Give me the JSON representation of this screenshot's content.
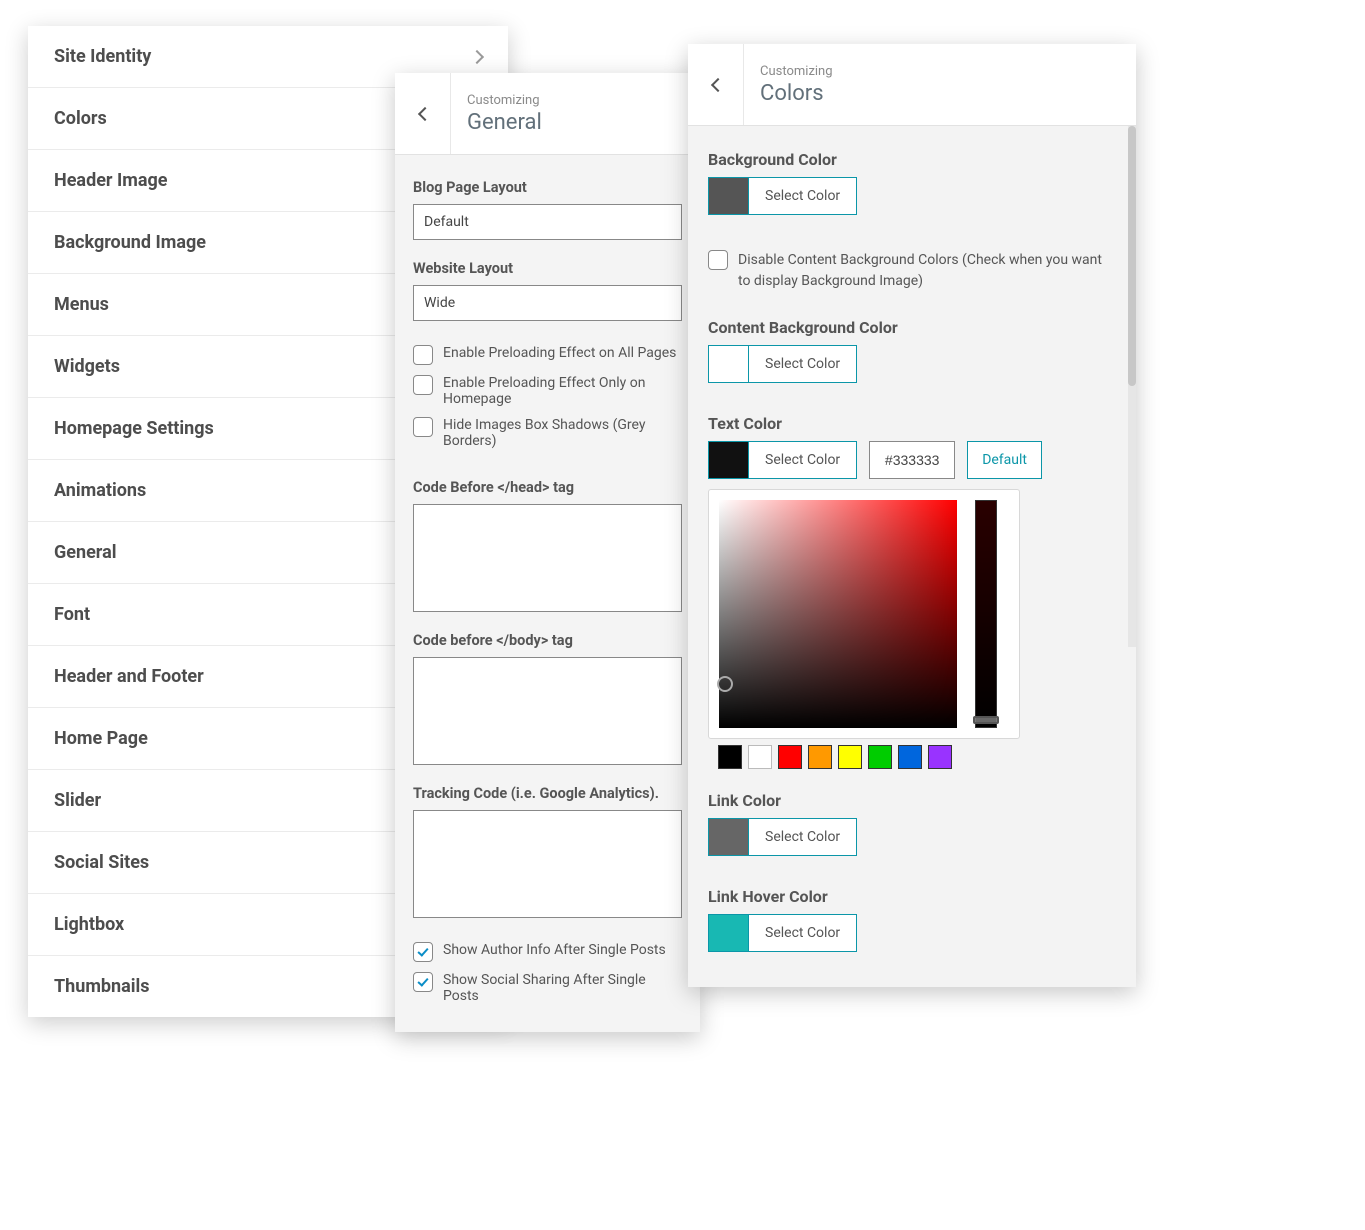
{
  "list_panel": {
    "items": [
      "Site Identity",
      "Colors",
      "Header Image",
      "Background Image",
      "Menus",
      "Widgets",
      "Homepage Settings",
      "Animations",
      "General",
      "Font",
      "Header and Footer",
      "Home Page",
      "Slider",
      "Social Sites",
      "Lightbox",
      "Thumbnails"
    ],
    "active_index": 0
  },
  "general_panel": {
    "header": {
      "crumb": "Customizing",
      "title": "General"
    },
    "blog_layout": {
      "label": "Blog Page Layout",
      "value": "Default"
    },
    "website_layout": {
      "label": "Website Layout",
      "value": "Wide"
    },
    "checkboxes": [
      {
        "label": "Enable Preloading Effect on All Pages",
        "checked": false
      },
      {
        "label": "Enable Preloading Effect Only on Homepage",
        "checked": false
      },
      {
        "label": "Hide Images Box Shadows (Grey Borders)",
        "checked": false
      }
    ],
    "code_head": {
      "label": "Code Before </head> tag"
    },
    "code_body": {
      "label": "Code before </body> tag"
    },
    "tracking": {
      "label": "Tracking Code (i.e. Google Analytics)."
    },
    "after_checks": [
      {
        "label": "Show Author Info After Single Posts",
        "checked": true
      },
      {
        "label": "Show Social Sharing After Single Posts",
        "checked": true
      }
    ]
  },
  "colors_panel": {
    "header": {
      "crumb": "Customizing",
      "title": "Colors"
    },
    "select_color_label": "Select Color",
    "default_label": "Default",
    "background": {
      "label": "Background Color",
      "swatch": "#555555"
    },
    "disable_bg_checkbox": {
      "label": "Disable Content Background Colors (Check when you want to display Background Image)",
      "checked": false
    },
    "content_bg": {
      "label": "Content Background Color",
      "swatch": "#ffffff"
    },
    "text_color": {
      "label": "Text Color",
      "swatch": "#111111",
      "hex": "#333333"
    },
    "presets": [
      "#000000",
      "#ffffff",
      "#ff0000",
      "#ff9900",
      "#ffff00",
      "#00cc00",
      "#0066dd",
      "#9933ff"
    ],
    "link_color": {
      "label": "Link Color",
      "swatch": "#666666"
    },
    "link_hover": {
      "label": "Link Hover Color",
      "swatch": "#18b8b3"
    }
  }
}
